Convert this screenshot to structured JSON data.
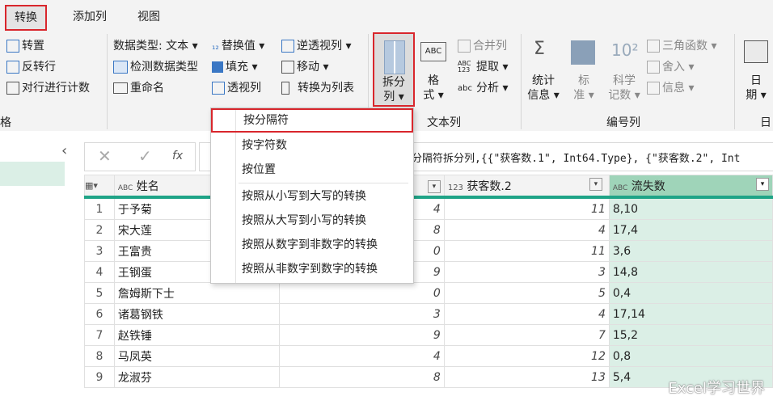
{
  "tabs": [
    "转换",
    "添加列",
    "视图"
  ],
  "table_group": {
    "transpose": "转置",
    "reverse_rows": "反转行",
    "count_rows": "对行进行计数",
    "group_label": "格"
  },
  "any_column": {
    "data_type": "数据类型: 文本 ▾",
    "detect_type": "检测数据类型",
    "rename": "重命名",
    "replace_values": "替换值 ▾",
    "fill": "填充 ▾",
    "pivot": "透视列",
    "unpivot": "逆透视列 ▾",
    "move": "移动 ▾",
    "to_list": "转换为列表"
  },
  "text_column": {
    "split_col_1": "拆分",
    "split_col_2": "列 ▾",
    "format_1": "格",
    "format_2": "式 ▾",
    "merge": "合并列",
    "extract": "提取 ▾",
    "parse": "分析 ▾",
    "abc_icon_text": "ABC",
    "abc123_icon_text": "ABC\n123",
    "abc_small_icon_text": "abc",
    "group_label": "文本列"
  },
  "number_column": {
    "stats_1": "统计",
    "stats_2": "信息 ▾",
    "standard_1": "标",
    "standard_2": "准 ▾",
    "sci_1": "科学",
    "sci_2": "记数 ▾",
    "trig": "三角函数 ▾",
    "round": "舍入 ▾",
    "info": "信息 ▾",
    "group_label": "编号列"
  },
  "date_column": {
    "date_1": "日",
    "date_2": "期 ▾",
    "group_label": "日"
  },
  "formula": {
    "fx": "fx",
    "text": "分隔符拆分列,{{\"获客数.1\", Int64.Type}, {\"获客数.2\", Int"
  },
  "split_menu": [
    "按分隔符",
    "按字符数",
    "按位置",
    "按照从小写到大写的转换",
    "按照从大写到小写的转换",
    "按照从数字到非数字的转换",
    "按照从非数字到数字的转换"
  ],
  "grid": {
    "headers": {
      "name_type": "ABC",
      "name": "姓名",
      "n2_type": "123",
      "n2": "获客数.2",
      "loss_type": "ABC",
      "loss": "流失数"
    },
    "rows": [
      {
        "n": "1",
        "name": "于予菊",
        "n1": "4",
        "n2": "11",
        "loss": "8,10"
      },
      {
        "n": "2",
        "name": "宋大莲",
        "n1": "8",
        "n2": "4",
        "loss": "17,4"
      },
      {
        "n": "3",
        "name": "王富贵",
        "n1": "0",
        "n2": "11",
        "loss": "3,6"
      },
      {
        "n": "4",
        "name": "王钢蛋",
        "n1": "9",
        "n2": "3",
        "loss": "14,8"
      },
      {
        "n": "5",
        "name": "詹姆斯下士",
        "n1": "0",
        "n2": "5",
        "loss": "0,4"
      },
      {
        "n": "6",
        "name": "诸葛钢铁",
        "n1": "3",
        "n2": "4",
        "loss": "17,14"
      },
      {
        "n": "7",
        "name": "赵铁锤",
        "n1": "9",
        "n2": "7",
        "loss": "15,2"
      },
      {
        "n": "8",
        "name": "马凤英",
        "n1": "4",
        "n2": "12",
        "loss": "0,8"
      },
      {
        "n": "9",
        "name": "龙淑芬",
        "n1": "8",
        "n2": "13",
        "loss": "5,4"
      }
    ]
  },
  "watermark": "Excel学习世界",
  "colors": {
    "accent_red": "#d9262c",
    "teal": "#1fa487",
    "selected_col": "#dbefe6"
  }
}
